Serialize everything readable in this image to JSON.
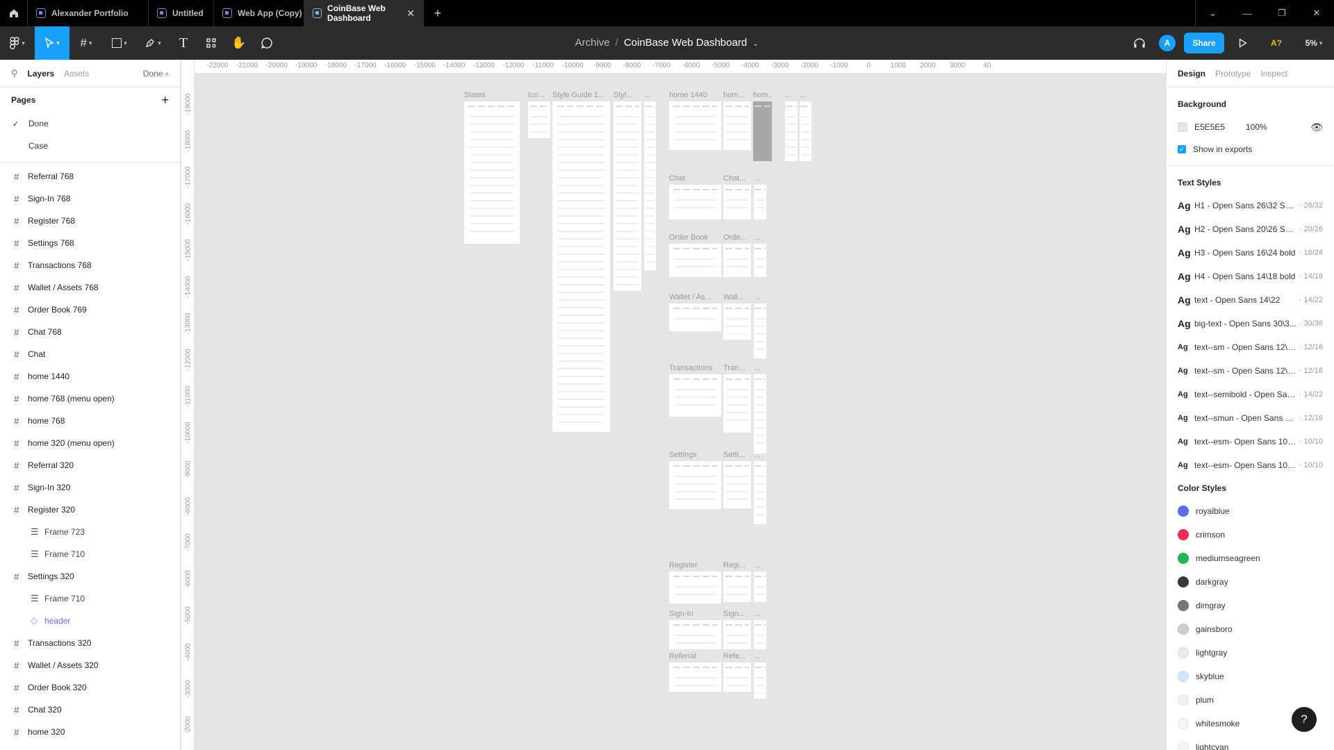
{
  "tabs": [
    {
      "label": "Alexander Portfolio"
    },
    {
      "label": "Untitled"
    },
    {
      "label": "Web App (Copy)"
    },
    {
      "label": "CoinBase Web Dashboard"
    }
  ],
  "add_tab_icon": "plus-icon",
  "breadcrumb": {
    "project": "Archive",
    "separator": "/",
    "file": "CoinBase Web Dashboard"
  },
  "toolbar_right": {
    "avatar": "A",
    "share": "Share",
    "warning": "A?",
    "zoom": "5%"
  },
  "left_panel": {
    "tabs": [
      "Layers",
      "Assets"
    ],
    "current_page": "Done",
    "pages_title": "Pages",
    "pages": [
      {
        "name": "Done",
        "selected": true
      },
      {
        "name": "Case",
        "selected": false
      }
    ],
    "layers": [
      {
        "name": "Referral 768",
        "type": "frame"
      },
      {
        "name": "Sign-In 768",
        "type": "frame"
      },
      {
        "name": "Register 768",
        "type": "frame"
      },
      {
        "name": "Settings 768",
        "type": "frame"
      },
      {
        "name": "Transactions 768",
        "type": "frame"
      },
      {
        "name": "Wallet / Assets 768",
        "type": "frame"
      },
      {
        "name": "Order Book 769",
        "type": "frame"
      },
      {
        "name": "Chat 768",
        "type": "frame"
      },
      {
        "name": "Chat",
        "type": "frame"
      },
      {
        "name": "home 1440",
        "type": "frame"
      },
      {
        "name": "home 768 (menu open)",
        "type": "frame"
      },
      {
        "name": "home 768",
        "type": "frame"
      },
      {
        "name": "home 320 (menu open)",
        "type": "frame"
      },
      {
        "name": "Referral 320",
        "type": "frame"
      },
      {
        "name": "Sign-In 320",
        "type": "frame"
      },
      {
        "name": "Register 320",
        "type": "frame"
      },
      {
        "name": "Frame 723",
        "type": "child"
      },
      {
        "name": "Frame 710",
        "type": "child"
      },
      {
        "name": "Settings 320",
        "type": "frame"
      },
      {
        "name": "Frame 710",
        "type": "child"
      },
      {
        "name": "header",
        "type": "component"
      },
      {
        "name": "Transactions 320",
        "type": "frame"
      },
      {
        "name": "Wallet / Assets 320",
        "type": "frame"
      },
      {
        "name": "Order Book 320",
        "type": "frame"
      },
      {
        "name": "Chat 320",
        "type": "frame"
      },
      {
        "name": "home 320",
        "type": "frame"
      }
    ]
  },
  "ruler": {
    "top": [
      "-22000",
      "-21000",
      "-20000",
      "-19000",
      "-18000",
      "-17000",
      "-16000",
      "-15000",
      "-14000",
      "-13000",
      "-12000",
      "-11000",
      "-10000",
      "-9000",
      "-8000",
      "-7000",
      "-6000",
      "-5000",
      "-4000",
      "-3000",
      "-2000",
      "-1000",
      "0",
      "1000",
      "2000",
      "3000",
      "40"
    ],
    "left": [
      "-19000",
      "-18000",
      "-17000",
      "-16000",
      "-15000",
      "-14000",
      "-13000",
      "-12000",
      "-11000",
      "-10000",
      "-9000",
      "-8000",
      "-7000",
      "-6000",
      "-5000",
      "-4000",
      "-3000",
      "-2000"
    ]
  },
  "canvas_frames": [
    {
      "label": "States"
    },
    {
      "label": "Ico..."
    },
    {
      "label": "Style Guide 1..."
    },
    {
      "label": "Styl..."
    },
    {
      "label": "..."
    },
    {
      "label": "home 1440"
    },
    {
      "label": "hom..."
    },
    {
      "label": "hom..."
    },
    {
      "label": "..."
    },
    {
      "label": "..."
    },
    {
      "label": "Chat"
    },
    {
      "label": "Chat..."
    },
    {
      "label": "..."
    },
    {
      "label": "Order Book"
    },
    {
      "label": "Orde..."
    },
    {
      "label": "..."
    },
    {
      "label": "Wallet / As..."
    },
    {
      "label": "Wall..."
    },
    {
      "label": "..."
    },
    {
      "label": "Transactions"
    },
    {
      "label": "Tran..."
    },
    {
      "label": "..."
    },
    {
      "label": "Settings"
    },
    {
      "label": "Setti..."
    },
    {
      "label": "..."
    },
    {
      "label": "Register"
    },
    {
      "label": "Regi..."
    },
    {
      "label": "..."
    },
    {
      "label": "Sign-In"
    },
    {
      "label": "Sign..."
    },
    {
      "label": "..."
    },
    {
      "label": "Referral"
    },
    {
      "label": "Refe..."
    },
    {
      "label": "..."
    }
  ],
  "right_panel": {
    "tabs": [
      "Design",
      "Prototype",
      "Inspect"
    ],
    "background_title": "Background",
    "background_hex": "E5E5E5",
    "background_opacity": "100%",
    "show_in_exports": "Show in exports",
    "text_styles_title": "Text Styles",
    "text_styles": [
      {
        "name": "H1 - Open Sans 26\\32 Se...",
        "meta": "26/32"
      },
      {
        "name": "H2 - Open Sans 20\\26 Se...",
        "meta": "20/26"
      },
      {
        "name": "H3 - Open Sans 16\\24 bold",
        "meta": "16/24"
      },
      {
        "name": "H4 - Open Sans 14\\18 bold",
        "meta": "14/18"
      },
      {
        "name": "text - Open Sans 14\\22",
        "meta": "14/22"
      },
      {
        "name": "big-text - Open Sans 30\\3...",
        "meta": "30/36"
      },
      {
        "name": "text--sm - Open Sans 12\\16",
        "meta": "12/16"
      },
      {
        "name": "text--sm - Open Sans 12\\1...",
        "meta": "12/16"
      },
      {
        "name": "text--semibold - Open San...",
        "meta": "14/22"
      },
      {
        "name": "text--smun - Open Sans 12...",
        "meta": "12/16"
      },
      {
        "name": "text--esm- Open Sans 10\\1...",
        "meta": "10/10"
      },
      {
        "name": "text--esm- Open Sans 10\\10",
        "meta": "10/10"
      }
    ],
    "color_styles_title": "Color Styles",
    "color_styles": [
      {
        "name": "royalblue",
        "color": "#5b6af0"
      },
      {
        "name": "crimson",
        "color": "#ee2e55"
      },
      {
        "name": "mediumseagreen",
        "color": "#1db954"
      },
      {
        "name": "darkgray",
        "color": "#3a3a3a"
      },
      {
        "name": "dimgray",
        "color": "#777777"
      },
      {
        "name": "gainsboro",
        "color": "#cccccc"
      },
      {
        "name": "lightgray",
        "color": "#e8ebf3"
      },
      {
        "name": "skyblue",
        "color": "#d3e6fb"
      },
      {
        "name": "plum",
        "color": "#f2f1f8"
      },
      {
        "name": "whitesmoke",
        "color": "#f5f5f5"
      },
      {
        "name": "lightcyan",
        "color": "#f0f9f6"
      }
    ]
  },
  "help_label": "?"
}
